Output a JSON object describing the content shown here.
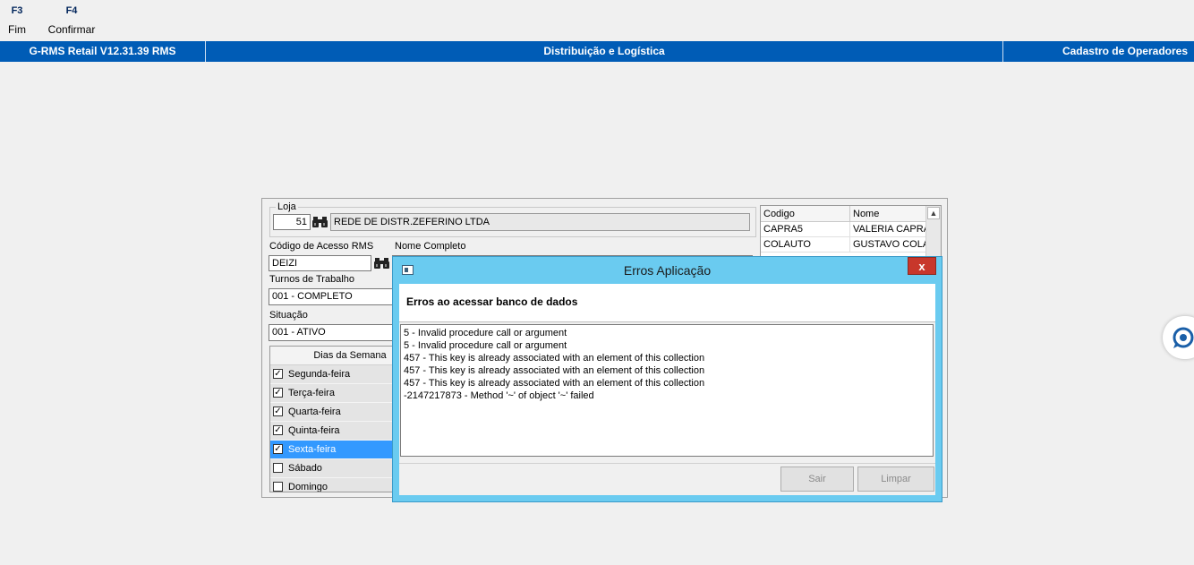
{
  "toolbar": {
    "f3": {
      "key": "F3",
      "label": "Fim"
    },
    "f4": {
      "key": "F4",
      "label": "Confirmar"
    }
  },
  "titlebar": {
    "app": "G-RMS Retail V12.31.39 RMS",
    "module": "Distribuição e Logística",
    "screen": "Cadastro de Operadores"
  },
  "form": {
    "loja_group": "Loja",
    "loja_code": "51",
    "loja_name": "REDE DE DISTR.ZEFERINO LTDA",
    "codigo_label": "Código de Acesso RMS",
    "codigo_value": "DEIZI",
    "nome_label": "Nome Completo",
    "turnos_label": "Turnos de Trabalho",
    "turnos_value": "001 - COMPLETO",
    "situacao_label": "Situação",
    "situacao_value": "001 - ATIVO",
    "dias_header": "Dias da Semana",
    "dias": [
      {
        "label": "Segunda-feira",
        "checked": true
      },
      {
        "label": "Terça-feira",
        "checked": true
      },
      {
        "label": "Quarta-feira",
        "checked": true
      },
      {
        "label": "Quinta-feira",
        "checked": true
      },
      {
        "label": "Sexta-feira",
        "checked": true
      },
      {
        "label": "Sábado",
        "checked": false
      },
      {
        "label": "Domingo",
        "checked": false
      }
    ],
    "grid": {
      "col_codigo": "Codigo",
      "col_nome": "Nome",
      "rows": [
        {
          "codigo": "CAPRA5",
          "nome": "VALERIA CAPRA"
        },
        {
          "codigo": "COLAUTO",
          "nome": "GUSTAVO COLA"
        }
      ]
    }
  },
  "dialog": {
    "title": "Erros Aplicação",
    "message": "Erros ao acessar banco de dados",
    "errors": [
      "5 - Invalid procedure call or argument",
      "5 - Invalid procedure call or argument",
      "457 - This key is already associated with an element of this collection",
      "457 - This key is already associated with an element of this collection",
      "457 - This key is already associated with an element of this collection",
      "-2147217873 - Method '~' of object '~' failed"
    ],
    "btn_sair": "Sair",
    "btn_limpar": "Limpar",
    "close": "x"
  },
  "colors": {
    "title_bar": "#005cb6",
    "dialog_frame": "#6acbf0",
    "close_button": "#c8372b",
    "selection": "#3399ff"
  }
}
